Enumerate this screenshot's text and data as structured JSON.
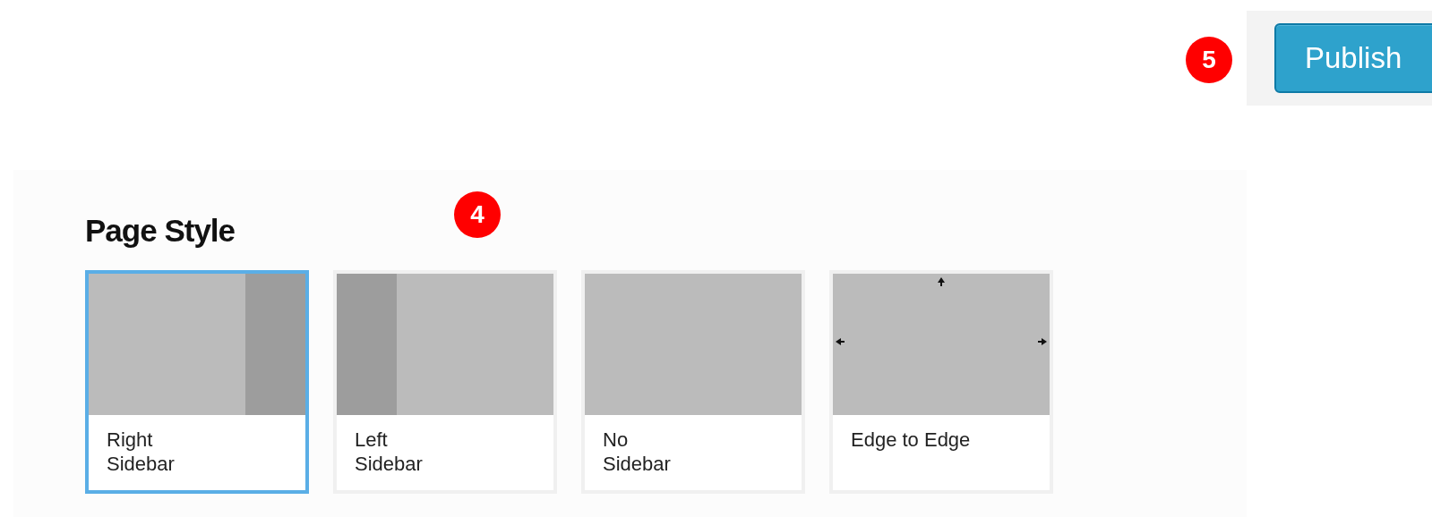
{
  "markers": [
    {
      "number": "5"
    },
    {
      "number": "4"
    }
  ],
  "publish_button": {
    "label": "Publish"
  },
  "page_style": {
    "title": "Page Style",
    "options": [
      {
        "label": "Right\nSidebar",
        "kind": "right",
        "selected": true
      },
      {
        "label": "Left\nSidebar",
        "kind": "left",
        "selected": false
      },
      {
        "label": "No\nSidebar",
        "kind": "none",
        "selected": false
      },
      {
        "label": "Edge to Edge",
        "kind": "edge",
        "selected": false
      }
    ]
  }
}
